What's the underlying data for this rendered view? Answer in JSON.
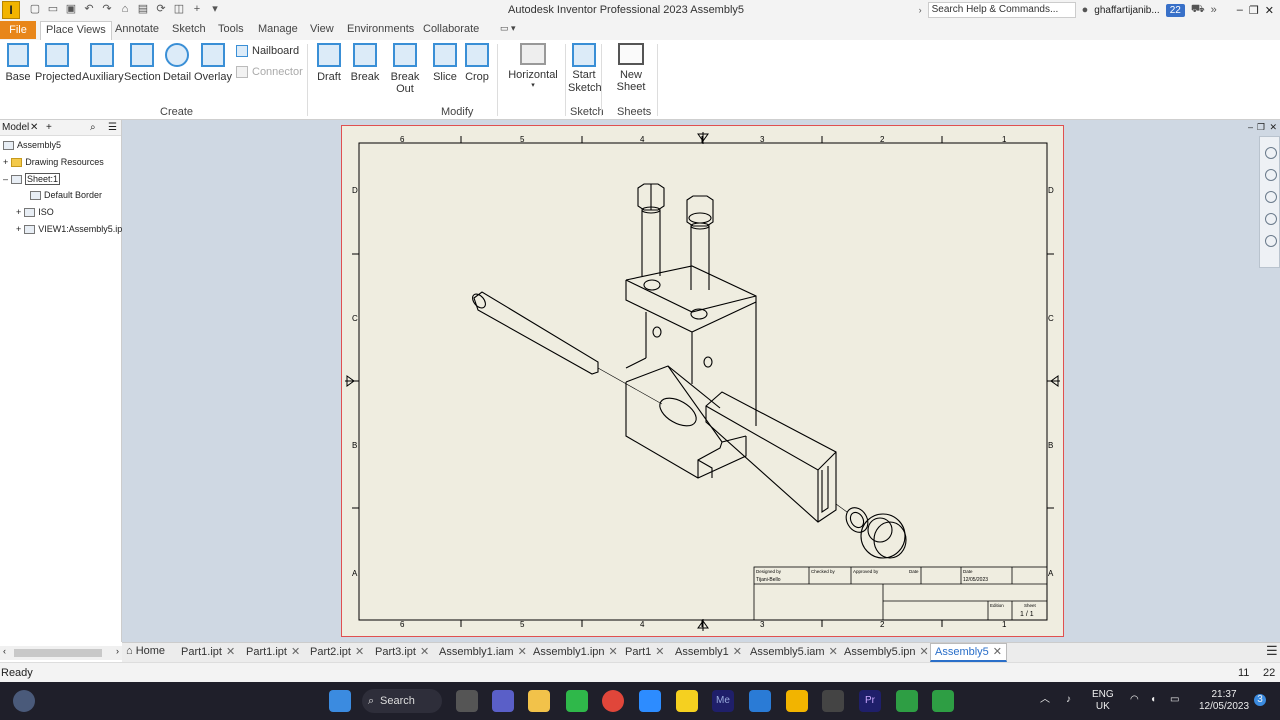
{
  "titlebar": {
    "logo": "I",
    "title": "Autodesk Inventor Professional 2023    Assembly5",
    "search_placeholder": "Search Help & Commands...",
    "user": "ghaffartijanib...",
    "notifications": "22"
  },
  "menu": {
    "file": "File",
    "tabs": [
      "Place Views",
      "Annotate",
      "Sketch",
      "Tools",
      "Manage",
      "View",
      "Environments",
      "Collaborate"
    ]
  },
  "ribbon": {
    "create": [
      "Base",
      "Projected",
      "Auxiliary",
      "Section",
      "Detail",
      "Overlay"
    ],
    "nailboard": "Nailboard",
    "connector": "Connector",
    "create_label": "Create",
    "modify": [
      "Draft",
      "Break",
      "Break Out",
      "Slice",
      "Crop"
    ],
    "horizontal": "Horizontal",
    "modify_label": "Modify",
    "start_sketch": "Start\nSketch",
    "sketch_label": "Sketch",
    "new_sheet": "New Sheet",
    "sheets_label": "Sheets"
  },
  "browser": {
    "tab": "Model",
    "items": [
      "Assembly5",
      "Drawing Resources",
      "Sheet:1",
      "Default Border",
      "ISO",
      "VIEW1:Assembly5.ip"
    ]
  },
  "drawing": {
    "columns": [
      "6",
      "5",
      "4",
      "3",
      "2",
      "1"
    ],
    "rows": [
      "D",
      "C",
      "B",
      "A"
    ],
    "title_block": {
      "designed_by_label": "Designed by",
      "designed_by": "Tijani-Bello",
      "checked_by_label": "Checked by",
      "approved_by_label": "Approved by",
      "date_label": "Date",
      "date_col": "Date",
      "date": "12/05/2023",
      "edition_label": "Edition",
      "sheet_label": "Sheet",
      "sheet": "1 / 1"
    }
  },
  "doctabs": {
    "home": "Home",
    "tabs": [
      "Part1.ipt",
      "Part1.ipt",
      "Part2.ipt",
      "Part3.ipt",
      "Assembly1.iam",
      "Assembly1.ipn",
      "Part1",
      "Assembly1",
      "Assembly5.iam",
      "Assembly5.ipn",
      "Assembly5"
    ]
  },
  "status": {
    "text": "Ready",
    "num1": "11",
    "num2": "22"
  },
  "taskbar": {
    "search": "Search",
    "lang1": "ENG",
    "lang2": "UK",
    "time": "21:37",
    "date": "12/05/2023",
    "notif": "3"
  },
  "colors": {
    "accent": "#2a6fc9",
    "file_tab": "#e8861a",
    "sheet": "#efede0",
    "workspace": "#cfd8e3"
  }
}
